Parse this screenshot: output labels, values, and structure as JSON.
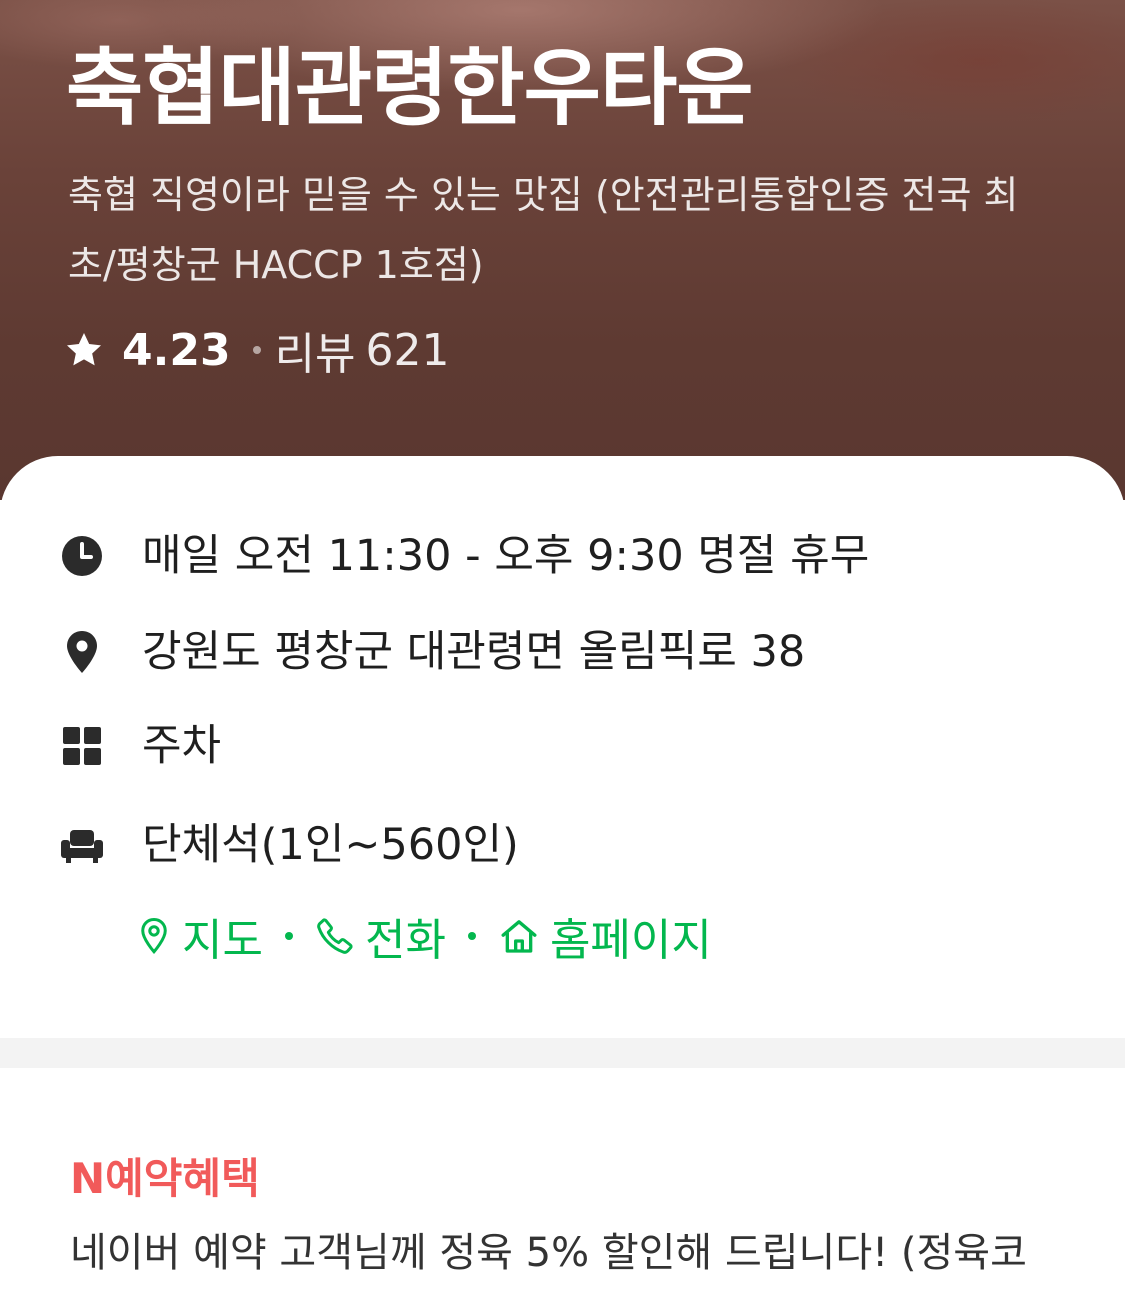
{
  "place": {
    "name": "축협대관령한우타운",
    "description": "축협 직영이라 믿을 수 있는 맛집 (안전관리통합인증 전국 최초/평창군 HACCP 1호점)",
    "rating": "4.23",
    "review_label": "리뷰",
    "review_count": "621"
  },
  "info": {
    "hours": "매일 오전 11:30 - 오후 9:30 명절 휴무",
    "address": "강원도 평창군 대관령면 올림픽로 38",
    "parking": "주차",
    "seating": "단체석(1인~560인)"
  },
  "icons": {
    "hours": "clock-icon",
    "address": "map-pin-icon",
    "parking": "grid-icon",
    "seating": "armchair-icon",
    "map_link": "map-pin-outline-icon",
    "phone_link": "phone-icon",
    "home_link": "home-icon",
    "rating": "star-icon"
  },
  "links": {
    "map": "지도",
    "phone": "전화",
    "homepage": "홈페이지"
  },
  "benefit": {
    "title": "N예약혜택",
    "description": "네이버 예약 고객님께 정육 5% 할인해 드립니다! (정육코"
  },
  "colors": {
    "link_green": "#03b74e",
    "benefit_red": "#f15a5a",
    "hero_brown": "#5e3a32",
    "icon_dark": "#2b2b2b"
  }
}
